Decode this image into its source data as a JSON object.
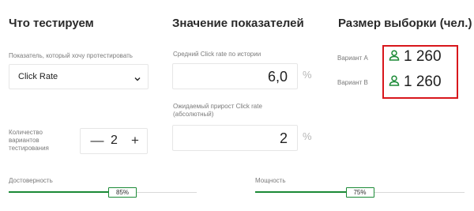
{
  "headers": {
    "what_testing": "Что тестируем",
    "metric_values": "Значение показателей",
    "sample_size": "Размер выборки (чел.)"
  },
  "metric": {
    "label": "Показатель, который хочу протестировать",
    "selected": "Click Rate"
  },
  "avg_click_rate": {
    "label": "Средний Click rate по истории",
    "value": "6,0",
    "unit": "%"
  },
  "expected_lift": {
    "label_line1": "Ожидаемый прирост Click rate",
    "label_line2": "(абсолютный)",
    "value": "2",
    "unit": "%"
  },
  "variants": {
    "label_line1": "Количество",
    "label_line2": "вариантов",
    "label_line3": "тестирования",
    "minus": "—",
    "plus": "+",
    "count": "2"
  },
  "results": [
    {
      "label": "Вариант A",
      "value": "1 260",
      "icon": "person-icon"
    },
    {
      "label": "Вариант B",
      "value": "1 260",
      "icon": "person-icon"
    }
  ],
  "confidence": {
    "label": "Достоверность",
    "value_text": "85%",
    "fraction": 0.85
  },
  "power": {
    "label": "Мощность",
    "value_text": "75%",
    "fraction": 0.75
  },
  "colors": {
    "accent": "#1b8a36",
    "highlight": "#d8171c"
  }
}
